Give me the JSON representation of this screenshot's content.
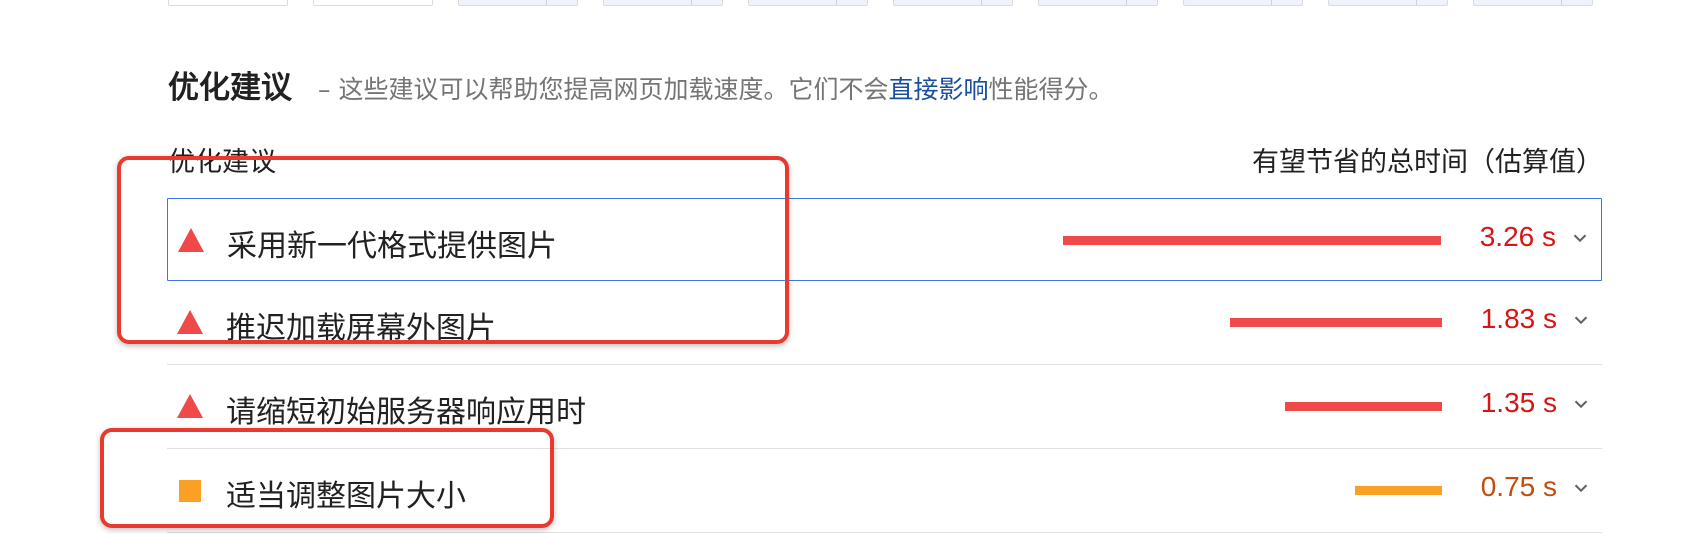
{
  "filmstrip": {
    "frames": [
      {
        "state": "blank"
      },
      {
        "state": "blank"
      },
      {
        "state": "loaded"
      },
      {
        "state": "loaded"
      },
      {
        "state": "loaded"
      },
      {
        "state": "loaded"
      },
      {
        "state": "loaded"
      },
      {
        "state": "loaded"
      },
      {
        "state": "loaded"
      },
      {
        "state": "loaded"
      }
    ]
  },
  "section": {
    "title": "优化建议",
    "desc_prefix": "– 这些建议可以帮助您提高网页加载速度。它们不会",
    "desc_link": "直接影响",
    "desc_suffix": "性能得分。"
  },
  "columns": {
    "left": "优化建议",
    "right": "有望节省的总时间（估算值）"
  },
  "colors": {
    "fail": "#f0494a",
    "fail_text": "#d71515",
    "average": "#faa125",
    "average_text": "#c44d0b",
    "selected_border": "#3b78e7",
    "link": "#1a4fa0",
    "annotation": "#e83a2d"
  },
  "audits": [
    {
      "title": "采用新一代格式提供图片",
      "value": "3.26 s",
      "seconds": 3.26,
      "severity": "fail",
      "icon": "warning-triangle-icon",
      "selected": true
    },
    {
      "title": "推迟加载屏幕外图片",
      "value": "1.83 s",
      "seconds": 1.83,
      "severity": "fail",
      "icon": "warning-triangle-icon",
      "selected": false
    },
    {
      "title": "请缩短初始服务器响应用时",
      "value": "1.35 s",
      "seconds": 1.35,
      "severity": "fail",
      "icon": "warning-triangle-icon",
      "selected": false
    },
    {
      "title": "适当调整图片大小",
      "value": "0.75 s",
      "seconds": 0.75,
      "severity": "average",
      "icon": "orange-square-icon",
      "selected": false
    }
  ],
  "annotations": [
    {
      "label": "red-highlight-box-top"
    },
    {
      "label": "red-highlight-box-bottom"
    }
  ]
}
